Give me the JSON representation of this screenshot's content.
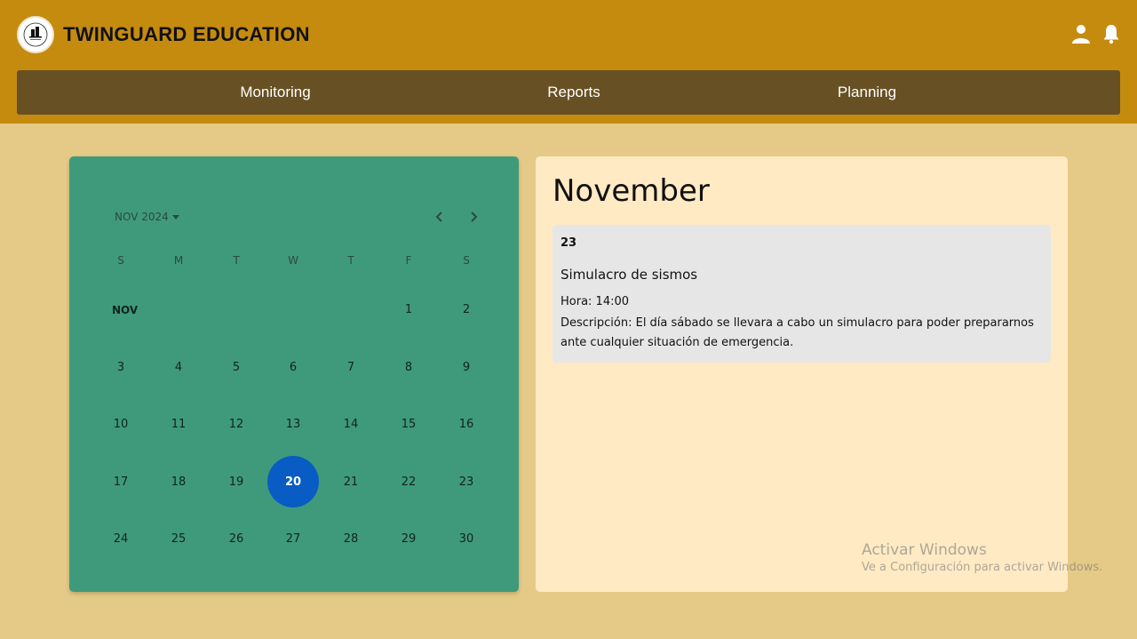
{
  "header": {
    "brand": "TWINGUARD EDUCATION",
    "logo_icon": "building-logo-icon",
    "user_icon": "user-icon",
    "notification_icon": "bell-icon"
  },
  "nav": {
    "items": [
      {
        "label": "Monitoring"
      },
      {
        "label": "Reports"
      },
      {
        "label": "Planning"
      }
    ]
  },
  "calendar": {
    "month_label": "NOV 2024",
    "month_tag": "NOV",
    "weekdays": [
      "S",
      "M",
      "T",
      "W",
      "T",
      "F",
      "S"
    ],
    "selected_day": "20",
    "weeks": [
      [
        "",
        "",
        "",
        "",
        "",
        "1",
        "2"
      ],
      [
        "3",
        "4",
        "5",
        "6",
        "7",
        "8",
        "9"
      ],
      [
        "10",
        "11",
        "12",
        "13",
        "14",
        "15",
        "16"
      ],
      [
        "17",
        "18",
        "19",
        "20",
        "21",
        "22",
        "23"
      ],
      [
        "24",
        "25",
        "26",
        "27",
        "28",
        "29",
        "30"
      ]
    ]
  },
  "events_panel": {
    "title": "November",
    "events": [
      {
        "day": "23",
        "title": "Simulacro de sismos",
        "time": "Hora: 14:00",
        "description": "Descripción: El día sábado se llevara a cabo un simulacro para poder prepararnos ante cualquier situación de emergencia."
      }
    ]
  },
  "watermark": {
    "title": "Activar Windows",
    "subtitle": "Ve a Configuración para activar Windows."
  },
  "colors": {
    "header_bg": "#c48b0e",
    "nav_bg": "#675023",
    "page_bg": "#e5ca87",
    "calendar_bg": "#3f9a7b",
    "selected_day": "#085cc4",
    "panel_bg": "#ffeac4",
    "card_bg": "#e6e6e6"
  }
}
